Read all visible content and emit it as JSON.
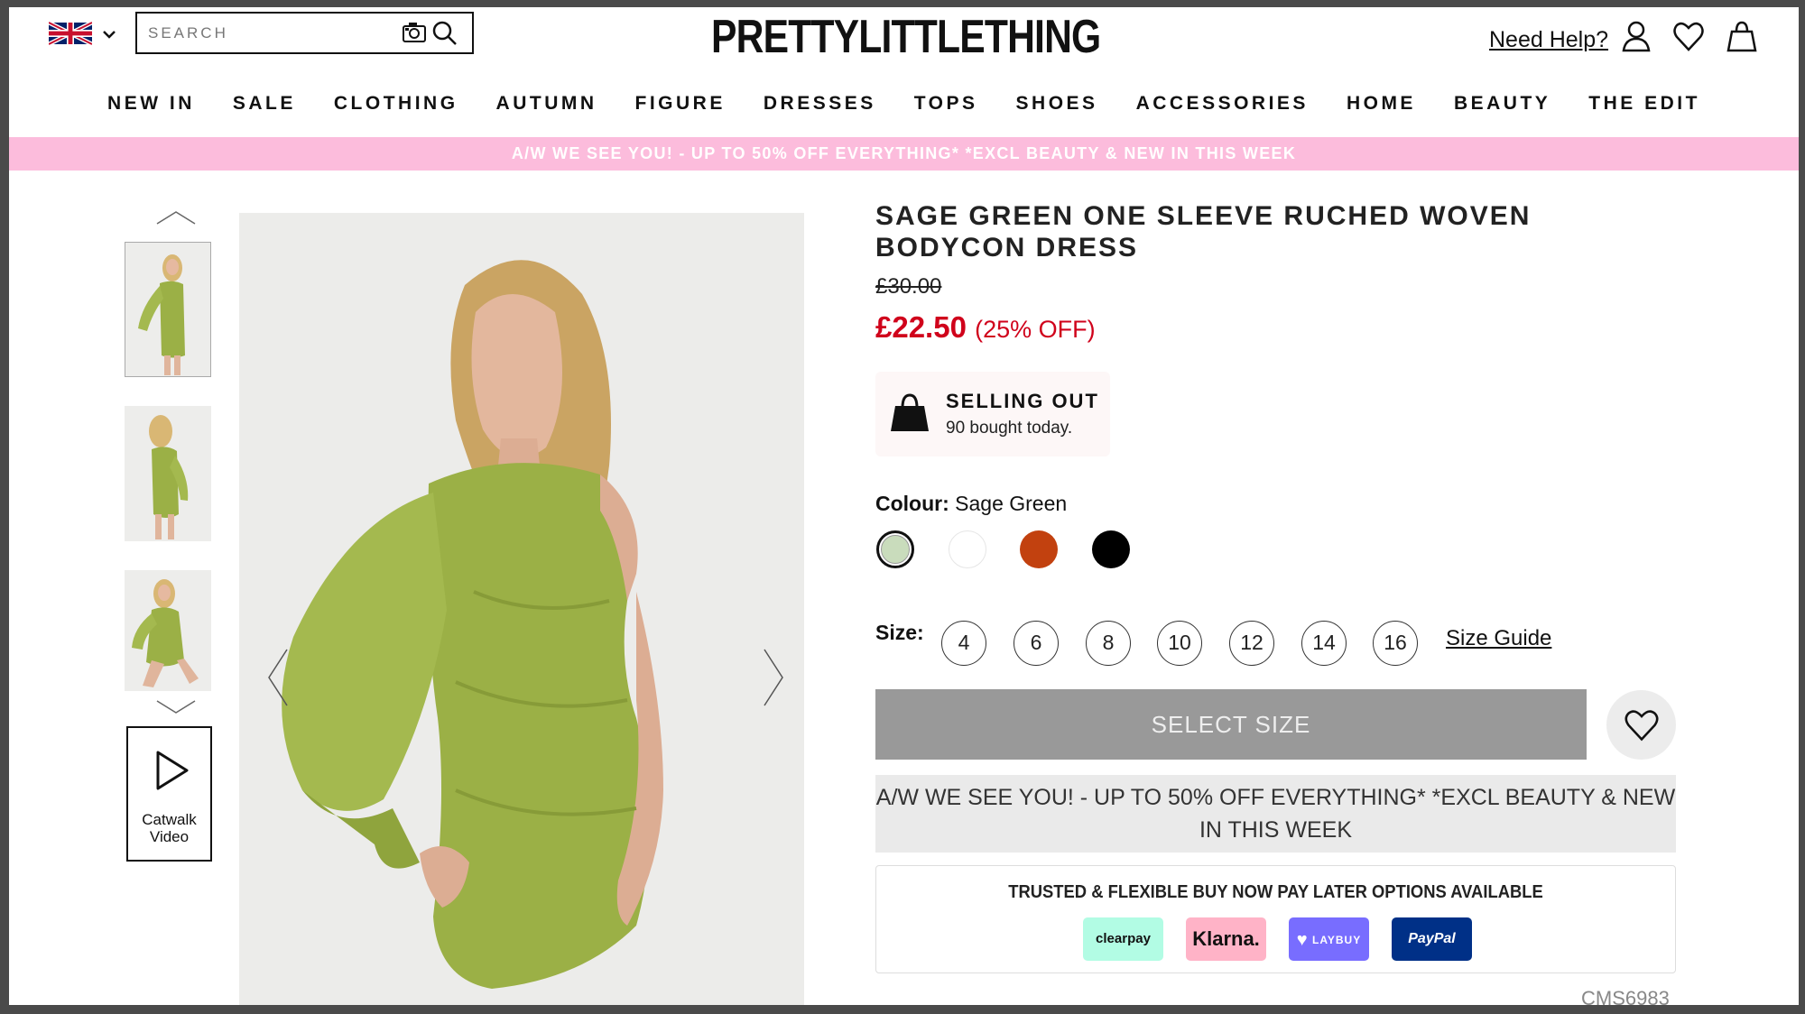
{
  "header": {
    "search_placeholder": "SEARCH",
    "logo": "PRETTYLITTLETHING",
    "need_help": "Need Help?",
    "icons": [
      "uk-flag-icon",
      "chevron-down-icon",
      "camera-icon",
      "search-icon",
      "account-icon",
      "heart-icon",
      "bag-icon"
    ]
  },
  "nav": [
    "NEW IN",
    "SALE",
    "CLOTHING",
    "AUTUMN",
    "FIGURE",
    "DRESSES",
    "TOPS",
    "SHOES",
    "ACCESSORIES",
    "HOME",
    "BEAUTY",
    "THE EDIT"
  ],
  "promo_bar": "A/W WE SEE YOU! - UP TO 50% OFF EVERYTHING* *EXCL BEAUTY & NEW IN THIS WEEK",
  "gallery": {
    "catwalk_label": "Catwalk Video"
  },
  "product": {
    "title": "SAGE GREEN ONE SLEEVE RUCHED WOVEN BODYCON DRESS",
    "old_price": "£30.00",
    "new_price": "£22.50",
    "discount": "(25% OFF)",
    "selling_title": "SELLING OUT",
    "selling_sub": "90 bought today.",
    "colour_label": "Colour:",
    "colour_value": "Sage Green",
    "colours": [
      "#c9dcbc",
      "#ffffff",
      "#c2410f",
      "#000000"
    ],
    "size_label": "Size:",
    "sizes": [
      "4",
      "6",
      "8",
      "10",
      "12",
      "14",
      "16"
    ],
    "size_guide": "Size Guide",
    "select_size": "SELECT SIZE",
    "promo_box": "A/W WE SEE YOU! - UP TO 50% OFF EVERYTHING* *EXCL BEAUTY & NEW IN THIS WEEK",
    "bnpl_title": "TRUSTED & FLEXIBLE BUY NOW PAY LATER OPTIONS AVAILABLE",
    "payment_options": [
      "clearpay",
      "Klarna.",
      "LAYBUY",
      "PayPal"
    ],
    "cms_code": "CMS6983"
  },
  "colors": {
    "promo_pink": "#fcbcdc",
    "price_red": "#d0021b",
    "dress_green": "#9bb046"
  }
}
